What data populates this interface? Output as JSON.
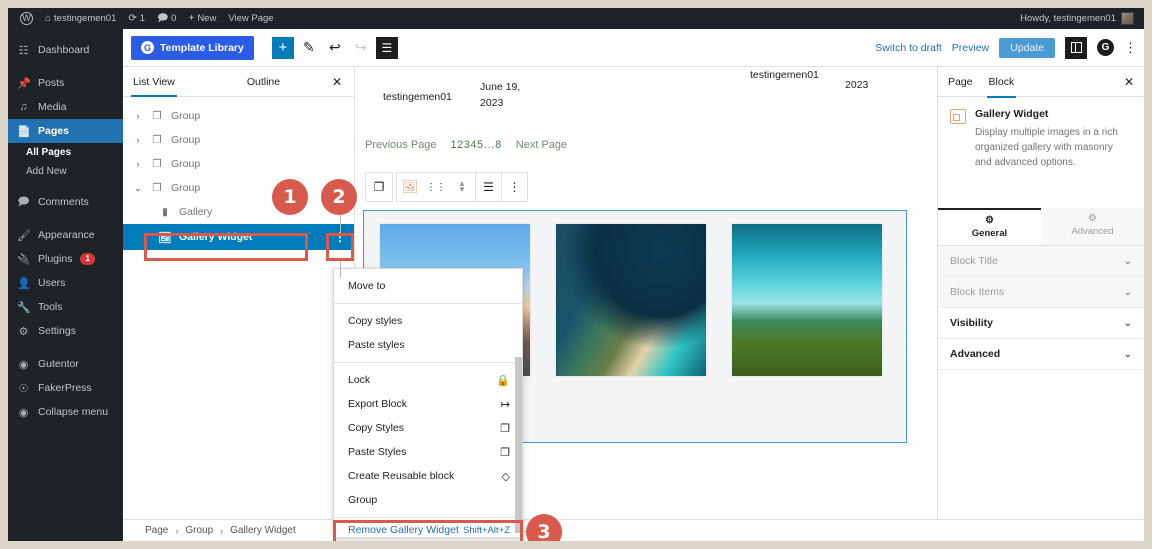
{
  "adminbar": {
    "wp_logo": "wordpress-logo",
    "site_name": "testingemen01",
    "updates_count": "1",
    "comments_count": "0",
    "new_label": "New",
    "view_page_label": "View Page",
    "howdy": "Howdy, testingemen01"
  },
  "adminmenu": {
    "items": [
      {
        "label": "Dashboard",
        "icon": "dashboard-icon",
        "active": false
      },
      {
        "label": "Posts",
        "icon": "pin-icon",
        "active": false
      },
      {
        "label": "Media",
        "icon": "media-icon",
        "active": false
      },
      {
        "label": "Pages",
        "icon": "pages-icon",
        "active": true
      },
      {
        "label": "Comments",
        "icon": "comment-icon",
        "active": false
      },
      {
        "label": "Appearance",
        "icon": "brush-icon",
        "active": false
      },
      {
        "label": "Plugins",
        "icon": "plug-icon",
        "active": false,
        "badge": "1"
      },
      {
        "label": "Users",
        "icon": "users-icon",
        "active": false
      },
      {
        "label": "Tools",
        "icon": "wrench-icon",
        "active": false
      },
      {
        "label": "Settings",
        "icon": "settings-icon",
        "active": false
      },
      {
        "label": "Gutentor",
        "icon": "gutentor-icon",
        "active": false
      },
      {
        "label": "FakerPress",
        "icon": "fakerpress-icon",
        "active": false
      },
      {
        "label": "Collapse menu",
        "icon": "collapse-icon",
        "active": false
      }
    ],
    "submenu": [
      {
        "label": "All Pages",
        "current": true
      },
      {
        "label": "Add New",
        "current": false
      }
    ]
  },
  "editor_header": {
    "template_library": "Template Library",
    "add_block": "+",
    "tools": [
      "add-block-icon",
      "edit-pencil-icon",
      "undo-icon",
      "redo-icon",
      "list-view-icon"
    ],
    "switch_to_draft": "Switch to draft",
    "preview": "Preview",
    "update": "Update",
    "settings_panel_icon": "settings-panel-icon",
    "gutentor_icon": "gutentor-icon",
    "options_icon": "kebab-menu-icon"
  },
  "listview": {
    "tabs": [
      {
        "label": "List View",
        "active": true
      },
      {
        "label": "Outline",
        "active": false
      }
    ],
    "close_icon": "close-icon",
    "rows": [
      {
        "label": "Group",
        "icon": "group-block-icon",
        "chevron": "›",
        "indent": false,
        "selected": false
      },
      {
        "label": "Group",
        "icon": "group-block-icon",
        "chevron": "›",
        "indent": false,
        "selected": false
      },
      {
        "label": "Group",
        "icon": "group-block-icon",
        "chevron": "›",
        "indent": false,
        "selected": false
      },
      {
        "label": "Group",
        "icon": "group-block-icon",
        "chevron": "⌄",
        "indent": false,
        "selected": false
      },
      {
        "label": "Gallery",
        "icon": "gallery-block-icon",
        "chevron": "",
        "indent": true,
        "selected": false
      },
      {
        "label": "Gallery Widget",
        "icon": "gallery-widget-icon",
        "chevron": "",
        "indent": true,
        "selected": true
      }
    ],
    "row_options_icon": "vertical-dots-icon"
  },
  "canvas": {
    "author_left": "testingemen01",
    "date_left": "June 19, 2023",
    "author_right": "testingemen01",
    "date_right": "2023",
    "pagination": {
      "previous": "Previous Page",
      "numbers": "12345…8",
      "next": "Next Page"
    },
    "block_toolbar": {
      "parent_icon": "parent-block-icon",
      "block_icon": "gallery-widget-icon",
      "drag_icon": "drag-handle-icon",
      "mover_icon": "move-up-down-icon",
      "align_icon": "align-icon",
      "options_icon": "kebab-menu-icon"
    },
    "gallery_images": [
      {
        "alt": "beach-sunset-photo"
      },
      {
        "alt": "cliff-coastline-photo"
      },
      {
        "alt": "aerial-turquoise-reef-photo"
      }
    ]
  },
  "context_menu": {
    "sections": [
      {
        "items": [
          {
            "label": "Move to",
            "icon": "",
            "shortcut": ""
          }
        ]
      },
      {
        "items": [
          {
            "label": "Copy styles",
            "icon": "",
            "shortcut": ""
          },
          {
            "label": "Paste styles",
            "icon": "",
            "shortcut": ""
          }
        ]
      },
      {
        "items": [
          {
            "label": "Lock",
            "icon": "lock-icon",
            "shortcut": ""
          },
          {
            "label": "Export Block",
            "icon": "export-icon",
            "shortcut": ""
          },
          {
            "label": "Copy Styles",
            "icon": "copy-icon",
            "shortcut": ""
          },
          {
            "label": "Paste Styles",
            "icon": "paste-icon",
            "shortcut": ""
          },
          {
            "label": "Create Reusable block",
            "icon": "reusable-block-icon",
            "shortcut": ""
          },
          {
            "label": "Group",
            "icon": "",
            "shortcut": ""
          }
        ]
      }
    ],
    "remove": {
      "label": "Remove Gallery Widget",
      "shortcut": "Shift+Alt+Z"
    }
  },
  "settings": {
    "tabs": [
      {
        "label": "Page",
        "active": false
      },
      {
        "label": "Block",
        "active": true
      }
    ],
    "close_icon": "close-icon",
    "block": {
      "icon": "gallery-widget-icon",
      "title": "Gallery Widget",
      "description": "Display multiple images in a rich organized gallery with masonry and advanced options."
    },
    "subtabs": [
      {
        "label": "General",
        "icon": "general-icon",
        "active": true
      },
      {
        "label": "Advanced",
        "icon": "gear-icon",
        "active": false
      }
    ],
    "accordions": [
      {
        "label": "Block Title",
        "muted": true,
        "chevron": "⌄"
      },
      {
        "label": "Block Items",
        "muted": true,
        "chevron": "⌄"
      },
      {
        "label": "Visibility",
        "muted": false,
        "chevron": "⌄"
      },
      {
        "label": "Advanced",
        "muted": false,
        "chevron": "⌄"
      }
    ]
  },
  "breadcrumbs": {
    "items": [
      "Page",
      "Group",
      "Gallery Widget"
    ],
    "separator": "›"
  },
  "callouts": [
    {
      "number": "1"
    },
    {
      "number": "2"
    },
    {
      "number": "3"
    }
  ],
  "colors": {
    "callout": "#d9594c",
    "wp_blue": "#2271b1",
    "selected_row": "#007cba",
    "template_btn": "#2b5ce6",
    "frame_bg": "#ded5c9"
  }
}
